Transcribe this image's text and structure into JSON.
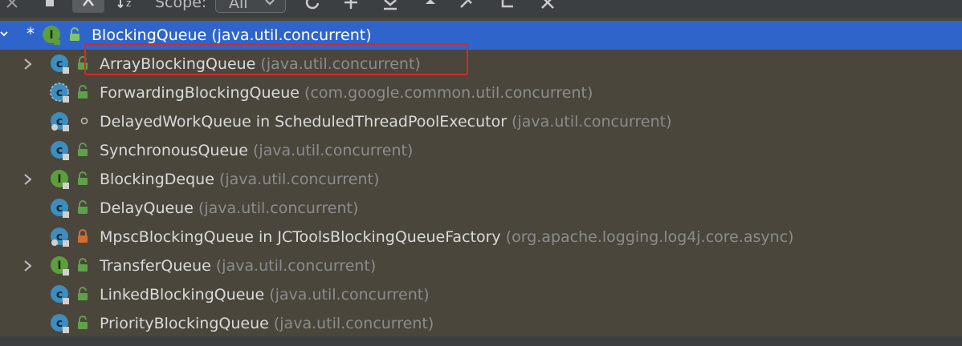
{
  "toolbar": {
    "scope_label": "Scope:",
    "scope_value": "All",
    "buttons": [
      "close-icon",
      "stop-icon",
      "class-hierarchy-icon",
      "sort-alpha-icon",
      "refresh-icon",
      "add-icon",
      "export-icon",
      "collapse-up-icon",
      "pin-icon",
      "open-in-tab-icon",
      "close-panel-icon"
    ]
  },
  "tree": {
    "root": {
      "name": "BlockingQueue",
      "pkg": "(java.util.concurrent)",
      "icon": "interface-icon"
    },
    "items": [
      {
        "name": "ArrayBlockingQueue",
        "pkg": "(java.util.concurrent)",
        "icon": "class-icon",
        "expandable": true
      },
      {
        "name": "ForwardingBlockingQueue",
        "pkg": "(com.google.common.util.concurrent)",
        "icon": "abstract-class-icon",
        "expandable": false
      },
      {
        "name": "DelayedWorkQueue in ScheduledThreadPoolExecutor",
        "pkg": "(java.util.concurrent)",
        "icon": "inner-class-icon",
        "expandable": false
      },
      {
        "name": "SynchronousQueue",
        "pkg": "(java.util.concurrent)",
        "icon": "class-icon",
        "expandable": false
      },
      {
        "name": "BlockingDeque",
        "pkg": "(java.util.concurrent)",
        "icon": "interface-icon",
        "expandable": true
      },
      {
        "name": "DelayQueue",
        "pkg": "(java.util.concurrent)",
        "icon": "class-icon",
        "expandable": false
      },
      {
        "name": "MpscBlockingQueue in JCToolsBlockingQueueFactory",
        "pkg": "(org.apache.logging.log4j.core.async)",
        "icon": "inner-class-icon",
        "expandable": false
      },
      {
        "name": "TransferQueue",
        "pkg": "(java.util.concurrent)",
        "icon": "interface-icon",
        "expandable": true
      },
      {
        "name": "LinkedBlockingQueue",
        "pkg": "(java.util.concurrent)",
        "icon": "class-icon",
        "expandable": false
      },
      {
        "name": "PriorityBlockingQueue",
        "pkg": "(java.util.concurrent)",
        "icon": "class-icon",
        "expandable": false
      }
    ]
  },
  "colors": {
    "selection": "#2f65ca",
    "highlight_border": "#d22a2a",
    "class_icon": "#3d8dbf",
    "interface_icon": "#5d9e3c",
    "public_lock": "#5ea14a",
    "private_lock": "#d46b32"
  }
}
